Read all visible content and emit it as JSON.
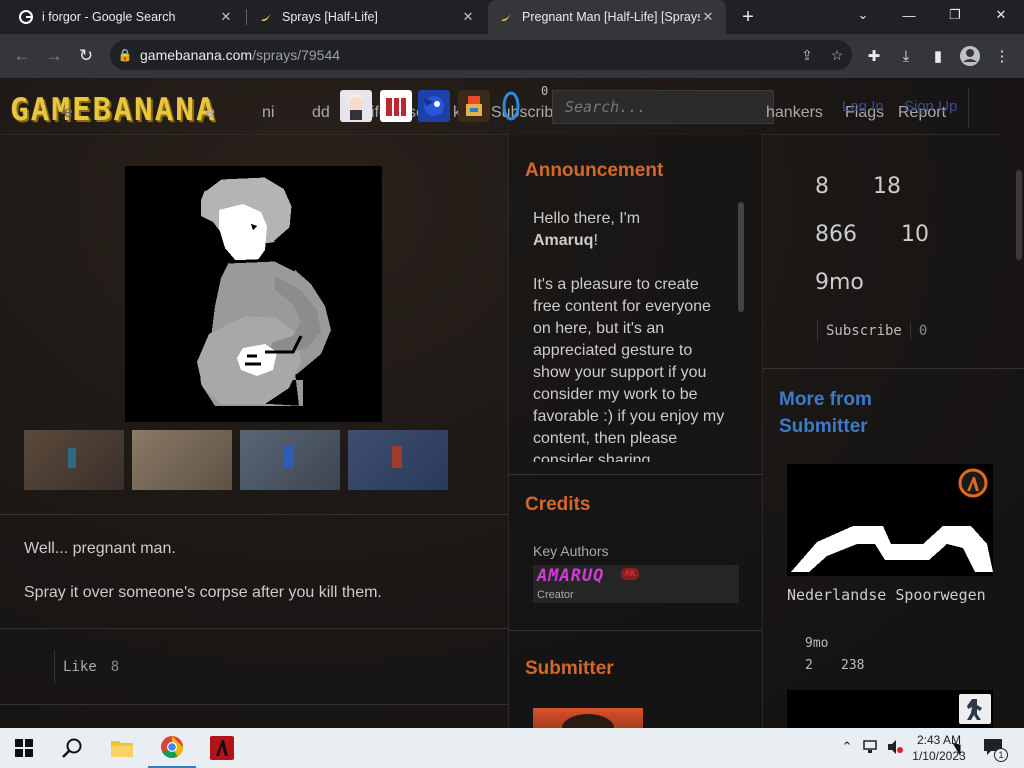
{
  "browser": {
    "tabs": [
      {
        "title": "i forgor - Google Search",
        "favicon": "google-icon",
        "active": false
      },
      {
        "title": "Sprays [Half-Life]",
        "favicon": "banana-icon",
        "active": false
      },
      {
        "title": "Pregnant Man [Half-Life] [Sprays]",
        "favicon": "banana-icon",
        "active": true
      }
    ],
    "url_host": "gamebanana.com",
    "url_path": "/sprays/79544"
  },
  "site": {
    "logo": "GAMEBANANA",
    "nav_fragments": [
      "e",
      "ni",
      "dd",
      "Life",
      "se",
      "ke",
      "Subscrib"
    ],
    "nav_links": [
      "hankers",
      "Flags",
      "Report"
    ],
    "search_placeholder": "Search...",
    "header_counter": "0",
    "login": "Log In",
    "signup": "Sign Up"
  },
  "description": {
    "line1": "Well... pregnant man.",
    "line2": "Spray it over someone's corpse after you kill them."
  },
  "like": {
    "label": "Like",
    "count": "8"
  },
  "announcement": {
    "title": "Announcement",
    "greeting_prefix": "Hello there, I'm",
    "greeting_name": "Amaruq",
    "greeting_suffix": "!",
    "body": "It's a pleasure to create free content for everyone on here, but it's an appreciated gesture to show your support if you consider my work to be favorable :) if you enjoy my content, then please consider sharing"
  },
  "credits": {
    "title": "Credits",
    "group": "Key Authors",
    "author_name": "AMARUQ",
    "author_badge": "AK",
    "author_role": "Creator"
  },
  "submitter": {
    "title": "Submitter"
  },
  "stats": {
    "s1": "8",
    "s2": "18",
    "s3": "866",
    "s4": "10",
    "age": "9mo"
  },
  "subscribe": {
    "label": "Subscribe",
    "count": "0"
  },
  "more_from": {
    "title": "More from Submitter",
    "item_name": "Nederlandse Spoorwegen",
    "item_age": "9mo",
    "item_likes": "2",
    "item_views": "238"
  },
  "taskbar": {
    "time": "2:43 AM",
    "date": "1/10/2023",
    "notification_count": "1"
  },
  "colors": {
    "orange_heading": "#d3682c",
    "blue_heading": "#3b7bc8",
    "logo_yellow": "#e9c640"
  }
}
